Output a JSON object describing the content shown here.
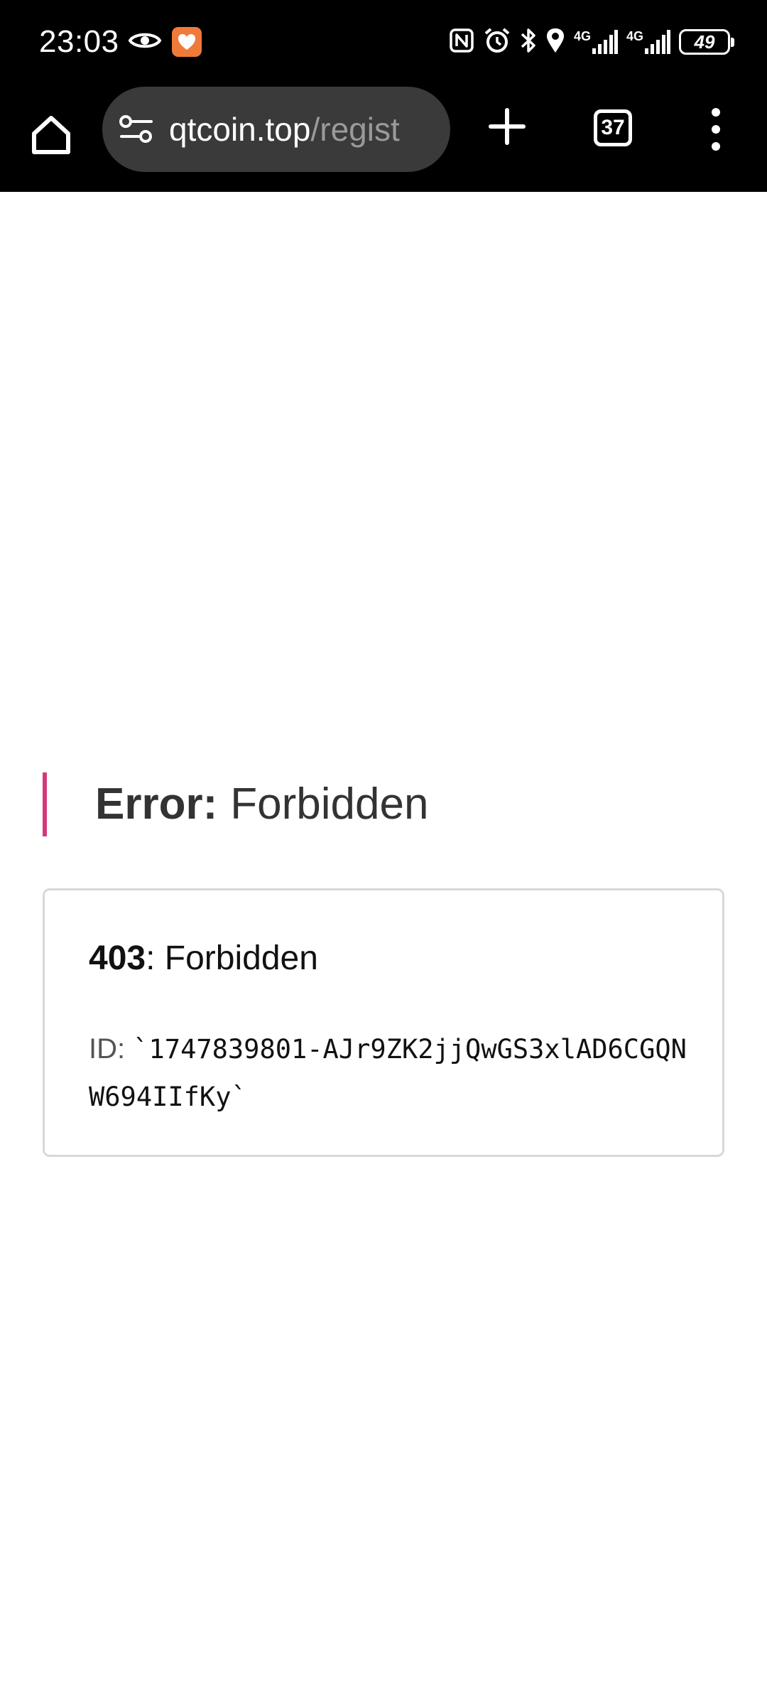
{
  "status_bar": {
    "time": "23:03",
    "network_label_1": "4G",
    "network_label_2": "4G",
    "battery_level": "49",
    "icons": [
      "eye-icon",
      "app-badge-icon",
      "nfc-icon",
      "alarm-icon",
      "bluetooth-icon",
      "location-icon",
      "signal-icon",
      "signal-icon",
      "battery-icon"
    ]
  },
  "browser": {
    "url_host": "qtcoin.top",
    "url_path": "/regist",
    "tab_count": "37"
  },
  "page": {
    "heading_label": "Error:",
    "heading_message": "Forbidden",
    "card": {
      "status_code": "403",
      "status_text": ": Forbidden",
      "id_label": "ID:",
      "id_value": "`1747839801-AJr9ZK2jjQwGS3xlAD6CGQNW694IIfKy`"
    }
  },
  "colors": {
    "accent_bar": "#d43a7a",
    "toolbar_bg": "#000000",
    "omnibox_bg": "#3a3a3a",
    "app_badge": "#f07a3a"
  }
}
